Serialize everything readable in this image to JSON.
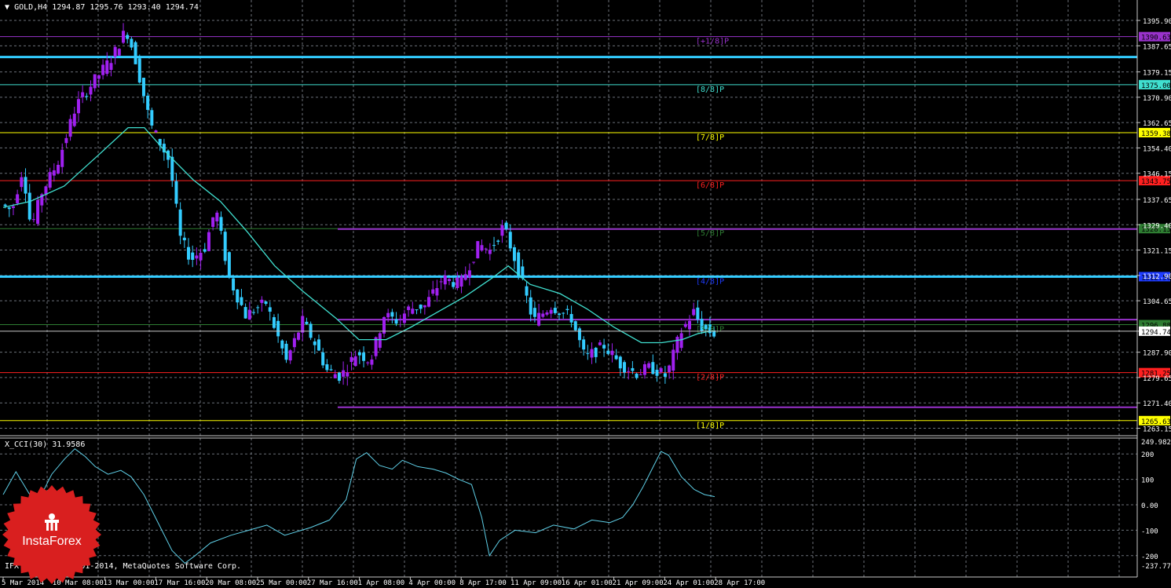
{
  "header": {
    "symbol_text": "GOLD,H4  1294.87 1295.76 1293.40 1294.74",
    "dropdown_icon": "triangle-down-icon"
  },
  "indicator_header": "X_CCI(30) 31.9586",
  "copyright": "IFX Trader, © 2001-2014, MetaQuotes Software Corp.",
  "logo": {
    "text": "InstaForex",
    "icon": "instaforex-emblem-icon",
    "color": "#d91f1f"
  },
  "colors": {
    "background": "#000000",
    "grid": "#6b7179",
    "bull": "#a020f0",
    "bear": "#33ccff",
    "ma": "#40e0d0",
    "cci": "#5fd0e8",
    "text": "#ffffff"
  },
  "chart_data": [
    {
      "type": "candlestick",
      "title": "GOLD,H4",
      "ohlc_current": {
        "open": 1294.87,
        "high": 1295.76,
        "low": 1293.4,
        "close": 1294.74
      },
      "ylim": [
        1262,
        1400
      ],
      "y_ticks": [
        1395.9,
        1387.65,
        1379.15,
        1370.9,
        1362.65,
        1354.4,
        1346.15,
        1337.65,
        1329.4,
        1321.15,
        1312.9,
        1304.65,
        1294.74,
        1287.9,
        1279.65,
        1271.4,
        1263.15
      ],
      "x_tick_labels": [
        "5 Mar 2014",
        "10 Mar 08:00",
        "13 Mar 00:00",
        "17 Mar 16:00",
        "20 Mar 08:00",
        "25 Mar 00:00",
        "27 Mar 16:00",
        "1 Apr 08:00",
        "4 Apr 00:00",
        "8 Apr 17:00",
        "11 Apr 09:00",
        "16 Apr 01:00",
        "21 Apr 09:00",
        "24 Apr 01:00",
        "28 Apr 17:00"
      ],
      "current_price": 1294.74,
      "grid": true,
      "price_path": [
        [
          0,
          1336
        ],
        [
          8,
          1334
        ],
        [
          16,
          1348
        ],
        [
          22,
          1328
        ],
        [
          30,
          1340
        ],
        [
          42,
          1350
        ],
        [
          55,
          1368
        ],
        [
          68,
          1376
        ],
        [
          82,
          1384
        ],
        [
          92,
          1393
        ],
        [
          98,
          1385
        ],
        [
          110,
          1362
        ],
        [
          124,
          1350
        ],
        [
          132,
          1325
        ],
        [
          140,
          1318
        ],
        [
          150,
          1322
        ],
        [
          158,
          1335
        ],
        [
          168,
          1312
        ],
        [
          180,
          1300
        ],
        [
          195,
          1304
        ],
        [
          210,
          1285
        ],
        [
          222,
          1298
        ],
        [
          232,
          1290
        ],
        [
          240,
          1282
        ],
        [
          250,
          1280
        ],
        [
          262,
          1288
        ],
        [
          272,
          1285
        ],
        [
          282,
          1300
        ],
        [
          292,
          1298
        ],
        [
          300,
          1302
        ],
        [
          312,
          1303
        ],
        [
          325,
          1312
        ],
        [
          338,
          1310
        ],
        [
          352,
          1323
        ],
        [
          360,
          1321
        ],
        [
          370,
          1329
        ],
        [
          380,
          1316
        ],
        [
          392,
          1298
        ],
        [
          405,
          1303
        ],
        [
          420,
          1299
        ],
        [
          430,
          1286
        ],
        [
          444,
          1290
        ],
        [
          456,
          1284
        ],
        [
          468,
          1281
        ],
        [
          478,
          1283
        ],
        [
          490,
          1280
        ],
        [
          500,
          1294
        ],
        [
          510,
          1301
        ],
        [
          516,
          1296
        ],
        [
          524,
          1294
        ]
      ],
      "moving_average_path": [
        [
          0,
          1335
        ],
        [
          20,
          1337
        ],
        [
          45,
          1342
        ],
        [
          70,
          1352
        ],
        [
          92,
          1361
        ],
        [
          104,
          1361
        ],
        [
          122,
          1352
        ],
        [
          140,
          1344
        ],
        [
          160,
          1337
        ],
        [
          180,
          1327
        ],
        [
          200,
          1316
        ],
        [
          220,
          1308
        ],
        [
          245,
          1299
        ],
        [
          262,
          1292
        ],
        [
          282,
          1292
        ],
        [
          300,
          1296
        ],
        [
          320,
          1301
        ],
        [
          340,
          1306
        ],
        [
          360,
          1312
        ],
        [
          372,
          1316
        ],
        [
          388,
          1310
        ],
        [
          410,
          1307
        ],
        [
          430,
          1302
        ],
        [
          450,
          1296
        ],
        [
          470,
          1291
        ],
        [
          485,
          1291
        ],
        [
          500,
          1292
        ],
        [
          512,
          1294
        ],
        [
          524,
          1295
        ]
      ],
      "levels": [
        {
          "label": "[+1/8]P",
          "value": 1390.63,
          "price_label": "1390.63",
          "color": "#9932cc",
          "kind": "murrey",
          "width": 1
        },
        {
          "label": "[8/8]P",
          "value": 1375.0,
          "price_label": "1375.00",
          "color": "#40e0d0",
          "kind": "murrey",
          "width": 1
        },
        {
          "label": "[7/8]P",
          "value": 1359.38,
          "price_label": "1359.38",
          "color": "#ffff00",
          "kind": "murrey",
          "width": 1
        },
        {
          "label": "[6/8]P",
          "value": 1343.75,
          "price_label": "1343.75",
          "color": "#ff2020",
          "kind": "murrey",
          "width": 1
        },
        {
          "label": "[5/8]P",
          "value": 1328.13,
          "price_label": "1328.13",
          "color": "#2e7d32",
          "kind": "murrey",
          "width": 1
        },
        {
          "label": "[4/8]P",
          "value": 1312.5,
          "price_label": "1312.50",
          "color": "#1e3cff",
          "kind": "murrey",
          "width": 1
        },
        {
          "label": "[3/8]P",
          "value": 1296.88,
          "price_label": "1296.88",
          "color": "#2e7d32",
          "kind": "murrey",
          "width": 1
        },
        {
          "label": "[2/8]P",
          "value": 1281.25,
          "price_label": "1281.25",
          "color": "#ff2020",
          "kind": "murrey",
          "width": 1
        },
        {
          "label": "[1/8]P",
          "value": 1265.63,
          "price_label": "1265.63",
          "color": "#ffff00",
          "kind": "murrey",
          "width": 1
        },
        {
          "label": "",
          "value": 1384.0,
          "price_label": "",
          "color": "#33ccff",
          "kind": "resistance",
          "width": 3
        },
        {
          "label": "",
          "value": 1312.5,
          "price_label": "",
          "color": "#33ccff",
          "kind": "resistance",
          "width": 3
        },
        {
          "label": "",
          "value": 1328.0,
          "price_label": "",
          "color": "#9932cc",
          "kind": "channel",
          "width": 2
        },
        {
          "label": "",
          "value": 1298.5,
          "price_label": "",
          "color": "#9932cc",
          "kind": "channel",
          "width": 2
        },
        {
          "label": "",
          "value": 1270.0,
          "price_label": "",
          "color": "#9932cc",
          "kind": "channel",
          "width": 2
        }
      ]
    },
    {
      "type": "line",
      "title": "X_CCI(30)",
      "last_value": 31.9586,
      "ylim": [
        -237.7724,
        249.9824
      ],
      "y_tick_labels": [
        "249.9824",
        "200",
        "100",
        "0.00",
        "-100",
        "-200",
        "-237.7724"
      ],
      "series": [
        {
          "values": [
            [
              0,
              40
            ],
            [
              10,
              130
            ],
            [
              16,
              80
            ],
            [
              22,
              30
            ],
            [
              30,
              40
            ],
            [
              38,
              120
            ],
            [
              48,
              180
            ],
            [
              56,
              220
            ],
            [
              64,
              190
            ],
            [
              72,
              150
            ],
            [
              82,
              120
            ],
            [
              92,
              135
            ],
            [
              100,
              110
            ],
            [
              110,
              40
            ],
            [
              120,
              -60
            ],
            [
              132,
              -180
            ],
            [
              142,
              -230
            ],
            [
              150,
              -200
            ],
            [
              162,
              -150
            ],
            [
              178,
              -120
            ],
            [
              192,
              -100
            ],
            [
              206,
              -80
            ],
            [
              220,
              -120
            ],
            [
              240,
              -90
            ],
            [
              255,
              -60
            ],
            [
              268,
              20
            ],
            [
              276,
              180
            ],
            [
              284,
              205
            ],
            [
              294,
              155
            ],
            [
              304,
              140
            ],
            [
              312,
              175
            ],
            [
              324,
              150
            ],
            [
              336,
              140
            ],
            [
              346,
              125
            ],
            [
              356,
              100
            ],
            [
              366,
              80
            ],
            [
              374,
              -50
            ],
            [
              380,
              -200
            ],
            [
              388,
              -140
            ],
            [
              400,
              -100
            ],
            [
              416,
              -110
            ],
            [
              430,
              -80
            ],
            [
              446,
              -95
            ],
            [
              460,
              -60
            ],
            [
              474,
              -70
            ],
            [
              484,
              -50
            ],
            [
              492,
              0
            ],
            [
              500,
              70
            ],
            [
              508,
              150
            ],
            [
              514,
              210
            ],
            [
              520,
              195
            ],
            [
              530,
              110
            ],
            [
              540,
              60
            ],
            [
              548,
              40
            ],
            [
              556,
              32
            ]
          ]
        }
      ]
    }
  ]
}
